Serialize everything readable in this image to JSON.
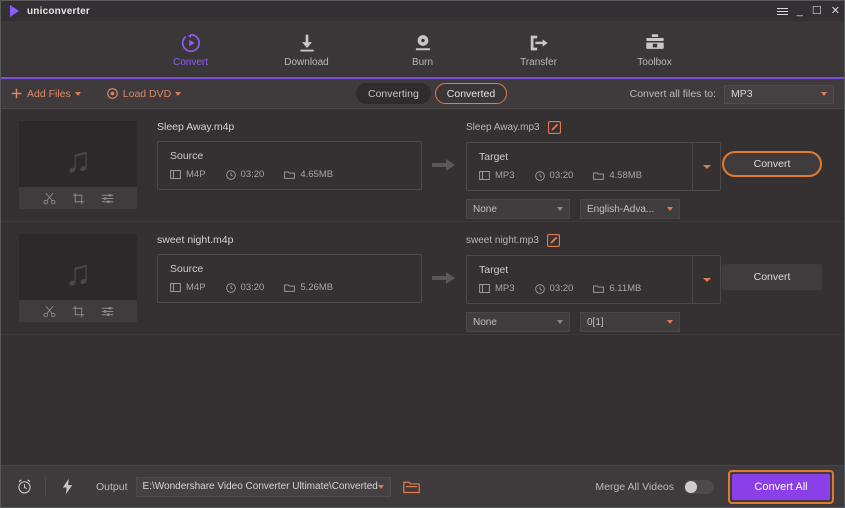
{
  "window": {
    "title": "uniconverter",
    "controls": [
      {
        "name": "menu-button",
        "glyph": "menu"
      },
      {
        "name": "minimize-button",
        "glyph": "_"
      },
      {
        "name": "maximize-button",
        "glyph": "□"
      },
      {
        "name": "close-button",
        "glyph": "✕"
      }
    ]
  },
  "nav": {
    "active": "Convert",
    "items": [
      {
        "label": "Convert",
        "icon": "convert-icon"
      },
      {
        "label": "Download",
        "icon": "download-icon"
      },
      {
        "label": "Burn",
        "icon": "burn-icon"
      },
      {
        "label": "Transfer",
        "icon": "transfer-icon"
      },
      {
        "label": "Toolbox",
        "icon": "toolbox-icon"
      }
    ]
  },
  "toolbar": {
    "add_files": "Add Files",
    "load_dvd": "Load DVD",
    "tabs": [
      {
        "label": "Converting",
        "active": false
      },
      {
        "label": "Converted",
        "active": true
      }
    ],
    "convert_all_to_label": "Convert all files to:",
    "convert_all_to_value": "MP3"
  },
  "files": [
    {
      "source_name": "Sleep Away.m4p",
      "source_label": "Source",
      "source_format": "M4P",
      "source_duration": "03:20",
      "source_size": "4.65MB",
      "target_name": "Sleep Away.mp3",
      "target_label": "Target",
      "target_format": "MP3",
      "target_duration": "03:20",
      "target_size": "4.58MB",
      "subtitle_select": "None",
      "audio_select": "English-Adva...",
      "convert_label": "Convert",
      "convert_highlighted": true
    },
    {
      "source_name": "sweet night.m4p",
      "source_label": "Source",
      "source_format": "M4P",
      "source_duration": "03:20",
      "source_size": "5.26MB",
      "target_name": "sweet night.mp3",
      "target_label": "Target",
      "target_format": "MP3",
      "target_duration": "03:20",
      "target_size": "6.11MB",
      "subtitle_select": "None",
      "audio_select": "0[1]",
      "convert_label": "Convert",
      "convert_highlighted": false
    }
  ],
  "bottom": {
    "output_label": "Output",
    "output_path": "E:\\Wondershare Video Converter Ultimate\\Converted",
    "merge_label": "Merge All Videos",
    "merge_on": false,
    "convert_all_label": "Convert All"
  },
  "colors": {
    "accent_purple": "#8b5cf6",
    "accent_orange": "#e07a2e",
    "convert_all_button": "#8b3fe8",
    "window_bg": "#3c3a3b"
  }
}
